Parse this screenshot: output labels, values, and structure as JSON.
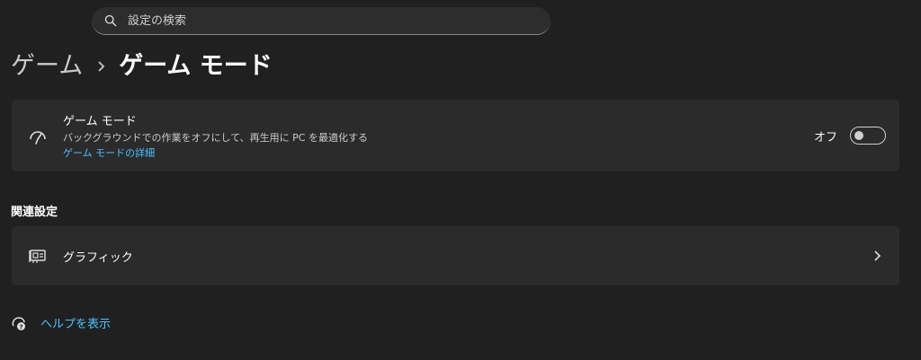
{
  "search": {
    "placeholder": "設定の検索",
    "icon": "search-icon"
  },
  "breadcrumb": {
    "parent": "ゲーム",
    "current": "ゲーム モード"
  },
  "game_mode": {
    "title": "ゲーム モード",
    "description": "バックグラウンドでの作業をオフにして、再生用に PC を最適化する",
    "link": "ゲーム モードの詳細",
    "toggle_label": "オフ",
    "toggle_state": "off",
    "icon": "game-mode-gauge-icon"
  },
  "related": {
    "heading": "関連設定",
    "items": [
      {
        "label": "グラフィック",
        "icon": "graphics-card-icon"
      }
    ]
  },
  "help": {
    "label": "ヘルプを表示",
    "icon": "help-icon"
  },
  "colors": {
    "background": "#202020",
    "card": "#2b2b2b",
    "accent_link": "#4cc2ff"
  }
}
